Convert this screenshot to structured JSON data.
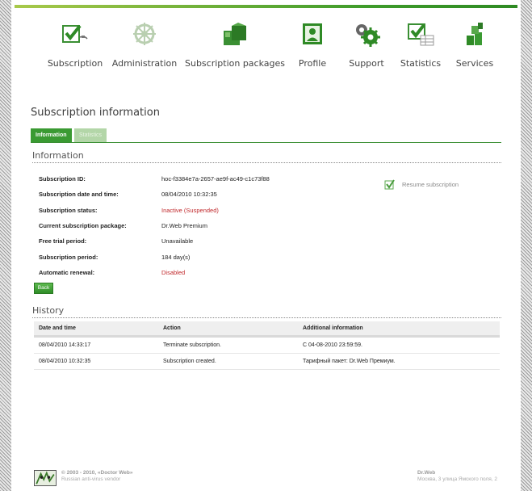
{
  "nav": {
    "items": [
      {
        "label": "Subscription",
        "icon": "subscription-icon"
      },
      {
        "label": "Administration",
        "icon": "administration-icon"
      },
      {
        "label": "Subscription packages",
        "icon": "packages-icon"
      },
      {
        "label": "Profile",
        "icon": "profile-icon"
      },
      {
        "label": "Support",
        "icon": "support-icon"
      },
      {
        "label": "Statistics",
        "icon": "statistics-icon"
      },
      {
        "label": "Services",
        "icon": "services-icon"
      }
    ]
  },
  "page": {
    "title": "Subscription information",
    "tabs": [
      {
        "label": "Information",
        "active": true
      },
      {
        "label": "Statistics",
        "active": false
      }
    ]
  },
  "information": {
    "title": "Information",
    "fields": [
      {
        "label": "Subscription ID:",
        "value": "hoc-f3384e7a-2657-ae9f-ac49-c1c73f88",
        "color": "normal"
      },
      {
        "label": "Subscription date and time:",
        "value": "08/04/2010 10:32:35",
        "color": "normal"
      },
      {
        "label": "Subscription status:",
        "value": "Inactive (Suspended)",
        "color": "red"
      },
      {
        "label": "Current subscription package:",
        "value": "Dr.Web Premium",
        "color": "normal"
      },
      {
        "label": "Free trial period:",
        "value": "Unavailable",
        "color": "normal"
      },
      {
        "label": "Subscription period:",
        "value": "184 day(s)",
        "color": "normal"
      },
      {
        "label": "Automatic renewal:",
        "value": "Disabled",
        "color": "red"
      }
    ],
    "resume_label": "Resume subscription",
    "back_label": "Back"
  },
  "history": {
    "title": "History",
    "columns": [
      "Date and time",
      "Action",
      "Additional information"
    ],
    "rows": [
      [
        "08/04/2010 14:33:17",
        "Terminate subscription.",
        "С 04-08-2010 23:59:59."
      ],
      [
        "08/04/2010 10:32:35",
        "Subscription created.",
        "Тарифный пакет: Dr.Web Премиум."
      ]
    ]
  },
  "footer": {
    "copyright": "© 2003 - 2010, «Doctor Web»",
    "tagline": "Russian anti-virus vendor",
    "company": "Dr.Web",
    "address": "Москва, 3 улица Ямского поля, 2"
  },
  "colors": {
    "accent": "#3a9a32",
    "alert": "#c0282b"
  }
}
